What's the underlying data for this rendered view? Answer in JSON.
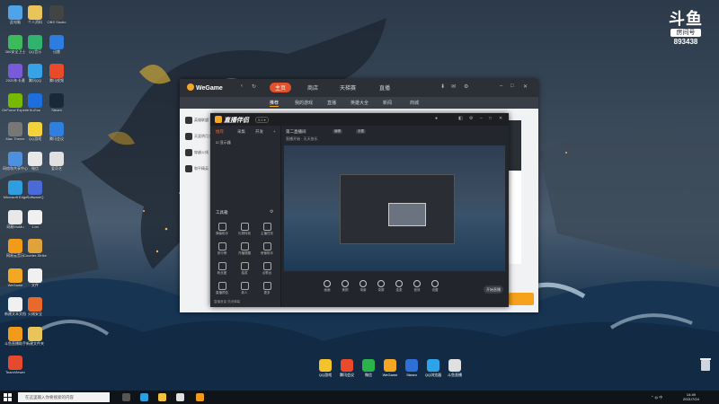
{
  "desktop": {
    "icons": [
      {
        "label": "此电脑",
        "color": "#4fa3e8"
      },
      {
        "label": "360安全卫士",
        "color": "#3dbb5a"
      },
      {
        "label": "2020年卡通",
        "color": "#7a5ad8"
      },
      {
        "label": "GeForce Experience",
        "color": "#76b900"
      },
      {
        "label": "Mac Theme",
        "color": "#777777"
      },
      {
        "label": "网络和共享中心",
        "color": "#4f8fe0"
      },
      {
        "label": "Microsoft Edge",
        "color": "#2f9ee0"
      },
      {
        "label": "网易MuMu",
        "color": "#e8e8e8"
      },
      {
        "label": "网易云音乐",
        "color": "#f29b1a"
      },
      {
        "label": "WeGame",
        "color": "#f5a623"
      },
      {
        "label": "新建文本文档",
        "color": "#f0f0f0"
      },
      {
        "label": "斗鱼直播助手",
        "color": "#f29b1a"
      },
      {
        "label": "TeamViewer",
        "color": "#e64a2e"
      },
      {
        "label": "个人资料",
        "color": "#e8c45a"
      },
      {
        "label": "QQ音乐",
        "color": "#2fb36d"
      },
      {
        "label": "腾讯QQ",
        "color": "#36a3e8"
      },
      {
        "label": "KuGou",
        "color": "#1d6fe0"
      },
      {
        "label": "QQ游戏",
        "color": "#f4d33a"
      },
      {
        "label": "微信",
        "color": "#e8e8e8"
      },
      {
        "label": "SoftwareQ",
        "color": "#4a6ad8"
      },
      {
        "label": "1.txt",
        "color": "#f0f0f0"
      },
      {
        "label": "Counter-Strike",
        "color": "#e0a23a"
      },
      {
        "label": "文件",
        "color": "#f0f0f0"
      },
      {
        "label": "火绒安全",
        "color": "#e8692a"
      },
      {
        "label": "新建文件夹",
        "color": "#e8c45a"
      },
      {
        "label": "OBS Studio",
        "color": "#444444"
      },
      {
        "label": "迅雷",
        "color": "#2d7de0"
      },
      {
        "label": "腾讯视频",
        "color": "#e84a2a"
      },
      {
        "label": "Steam",
        "color": "#1b2838"
      },
      {
        "label": "腾讯会议",
        "color": "#2f7fe0"
      },
      {
        "label": "爱奇艺",
        "color": "#e0e0e0"
      }
    ]
  },
  "watermark": {
    "logo": "斗鱼",
    "sub": "房间号",
    "room": "893438"
  },
  "wegame": {
    "brand": "WeGame",
    "tabs": [
      "主页",
      "商店",
      "天梯赛",
      "直播"
    ],
    "active_tab": "主页",
    "subtabs": [
      "推荐",
      "我的游戏",
      "直播",
      "英雄大全",
      "新闻",
      "商城"
    ],
    "side": [
      "英雄联盟",
      "天涯明月刀",
      "穿越火线",
      "和平精英"
    ]
  },
  "douyu": {
    "brand": "直播伴侣",
    "version": "5.0 ▾",
    "tabs": [
      "推荐",
      "采集",
      "开发"
    ],
    "source": "显示器",
    "room_title": "第二直播间",
    "room_sub": "直播开始 · 天天快乐",
    "pill1": "编辑",
    "pill2": "设置",
    "tools_title": "工具箱",
    "tools": [
      "弹幕助手",
      "礼物特效",
      "主播任务",
      "排行榜",
      "开播提醒",
      "房管助手",
      "粉丝团",
      "抽奖",
      "点歌台",
      "直播预告",
      "新人",
      "更多"
    ],
    "bottom": [
      "画面",
      "美颜",
      "场景",
      "录屏",
      "连麦",
      "音效",
      "设置"
    ],
    "live_btn": "开始直播",
    "footer": "直播音量 关闭弹幕"
  },
  "dock": [
    {
      "label": "QQ游戏",
      "color": "#f4c22a"
    },
    {
      "label": "腾讯会议",
      "color": "#e84a2a"
    },
    {
      "label": "微信",
      "color": "#2bb34b"
    },
    {
      "label": "WeGame",
      "color": "#f5a623"
    },
    {
      "label": "Steam",
      "color": "#2f6fd8"
    },
    {
      "label": "QQ浏览器",
      "color": "#2da4ea"
    },
    {
      "label": "斗鱼直播",
      "color": "#e0e0e0"
    }
  ],
  "taskbar": {
    "search_placeholder": "在这里输入你要搜索的内容",
    "tray": "⌃ ◍ 中",
    "time": "14:49",
    "date": "2021/7/24"
  }
}
